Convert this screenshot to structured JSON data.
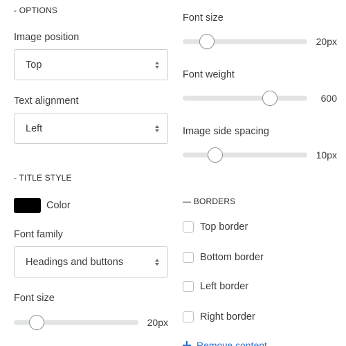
{
  "left": {
    "options_heading": "- OPTIONS",
    "image_position": {
      "label": "Image position",
      "value": "Top"
    },
    "text_alignment": {
      "label": "Text alignment",
      "value": "Left"
    },
    "title_style_heading": "- TITLE STYLE",
    "color": {
      "label": "Color",
      "swatch": "#000000"
    },
    "font_family": {
      "label": "Font family",
      "value": "Headings and buttons"
    },
    "font_size": {
      "label": "Font size",
      "value": "20px",
      "level": 0.14
    }
  },
  "right": {
    "font_size": {
      "label": "Font size",
      "value": "20px",
      "level": 0.15
    },
    "font_weight": {
      "label": "Font weight",
      "value": "600",
      "level": 0.73
    },
    "image_side_spacing": {
      "label": "Image side spacing",
      "value": "10px",
      "level": 0.23
    },
    "borders_heading": "— BORDERS",
    "borders": [
      {
        "label": "Top border",
        "checked": false
      },
      {
        "label": "Bottom border",
        "checked": false
      },
      {
        "label": "Left border",
        "checked": false
      },
      {
        "label": "Right border",
        "checked": false
      }
    ],
    "remove_content": "Remove content"
  },
  "colors": {
    "track": "#e1e3e5",
    "thumb_border": "#8a9299",
    "link": "#2c6ecb"
  }
}
